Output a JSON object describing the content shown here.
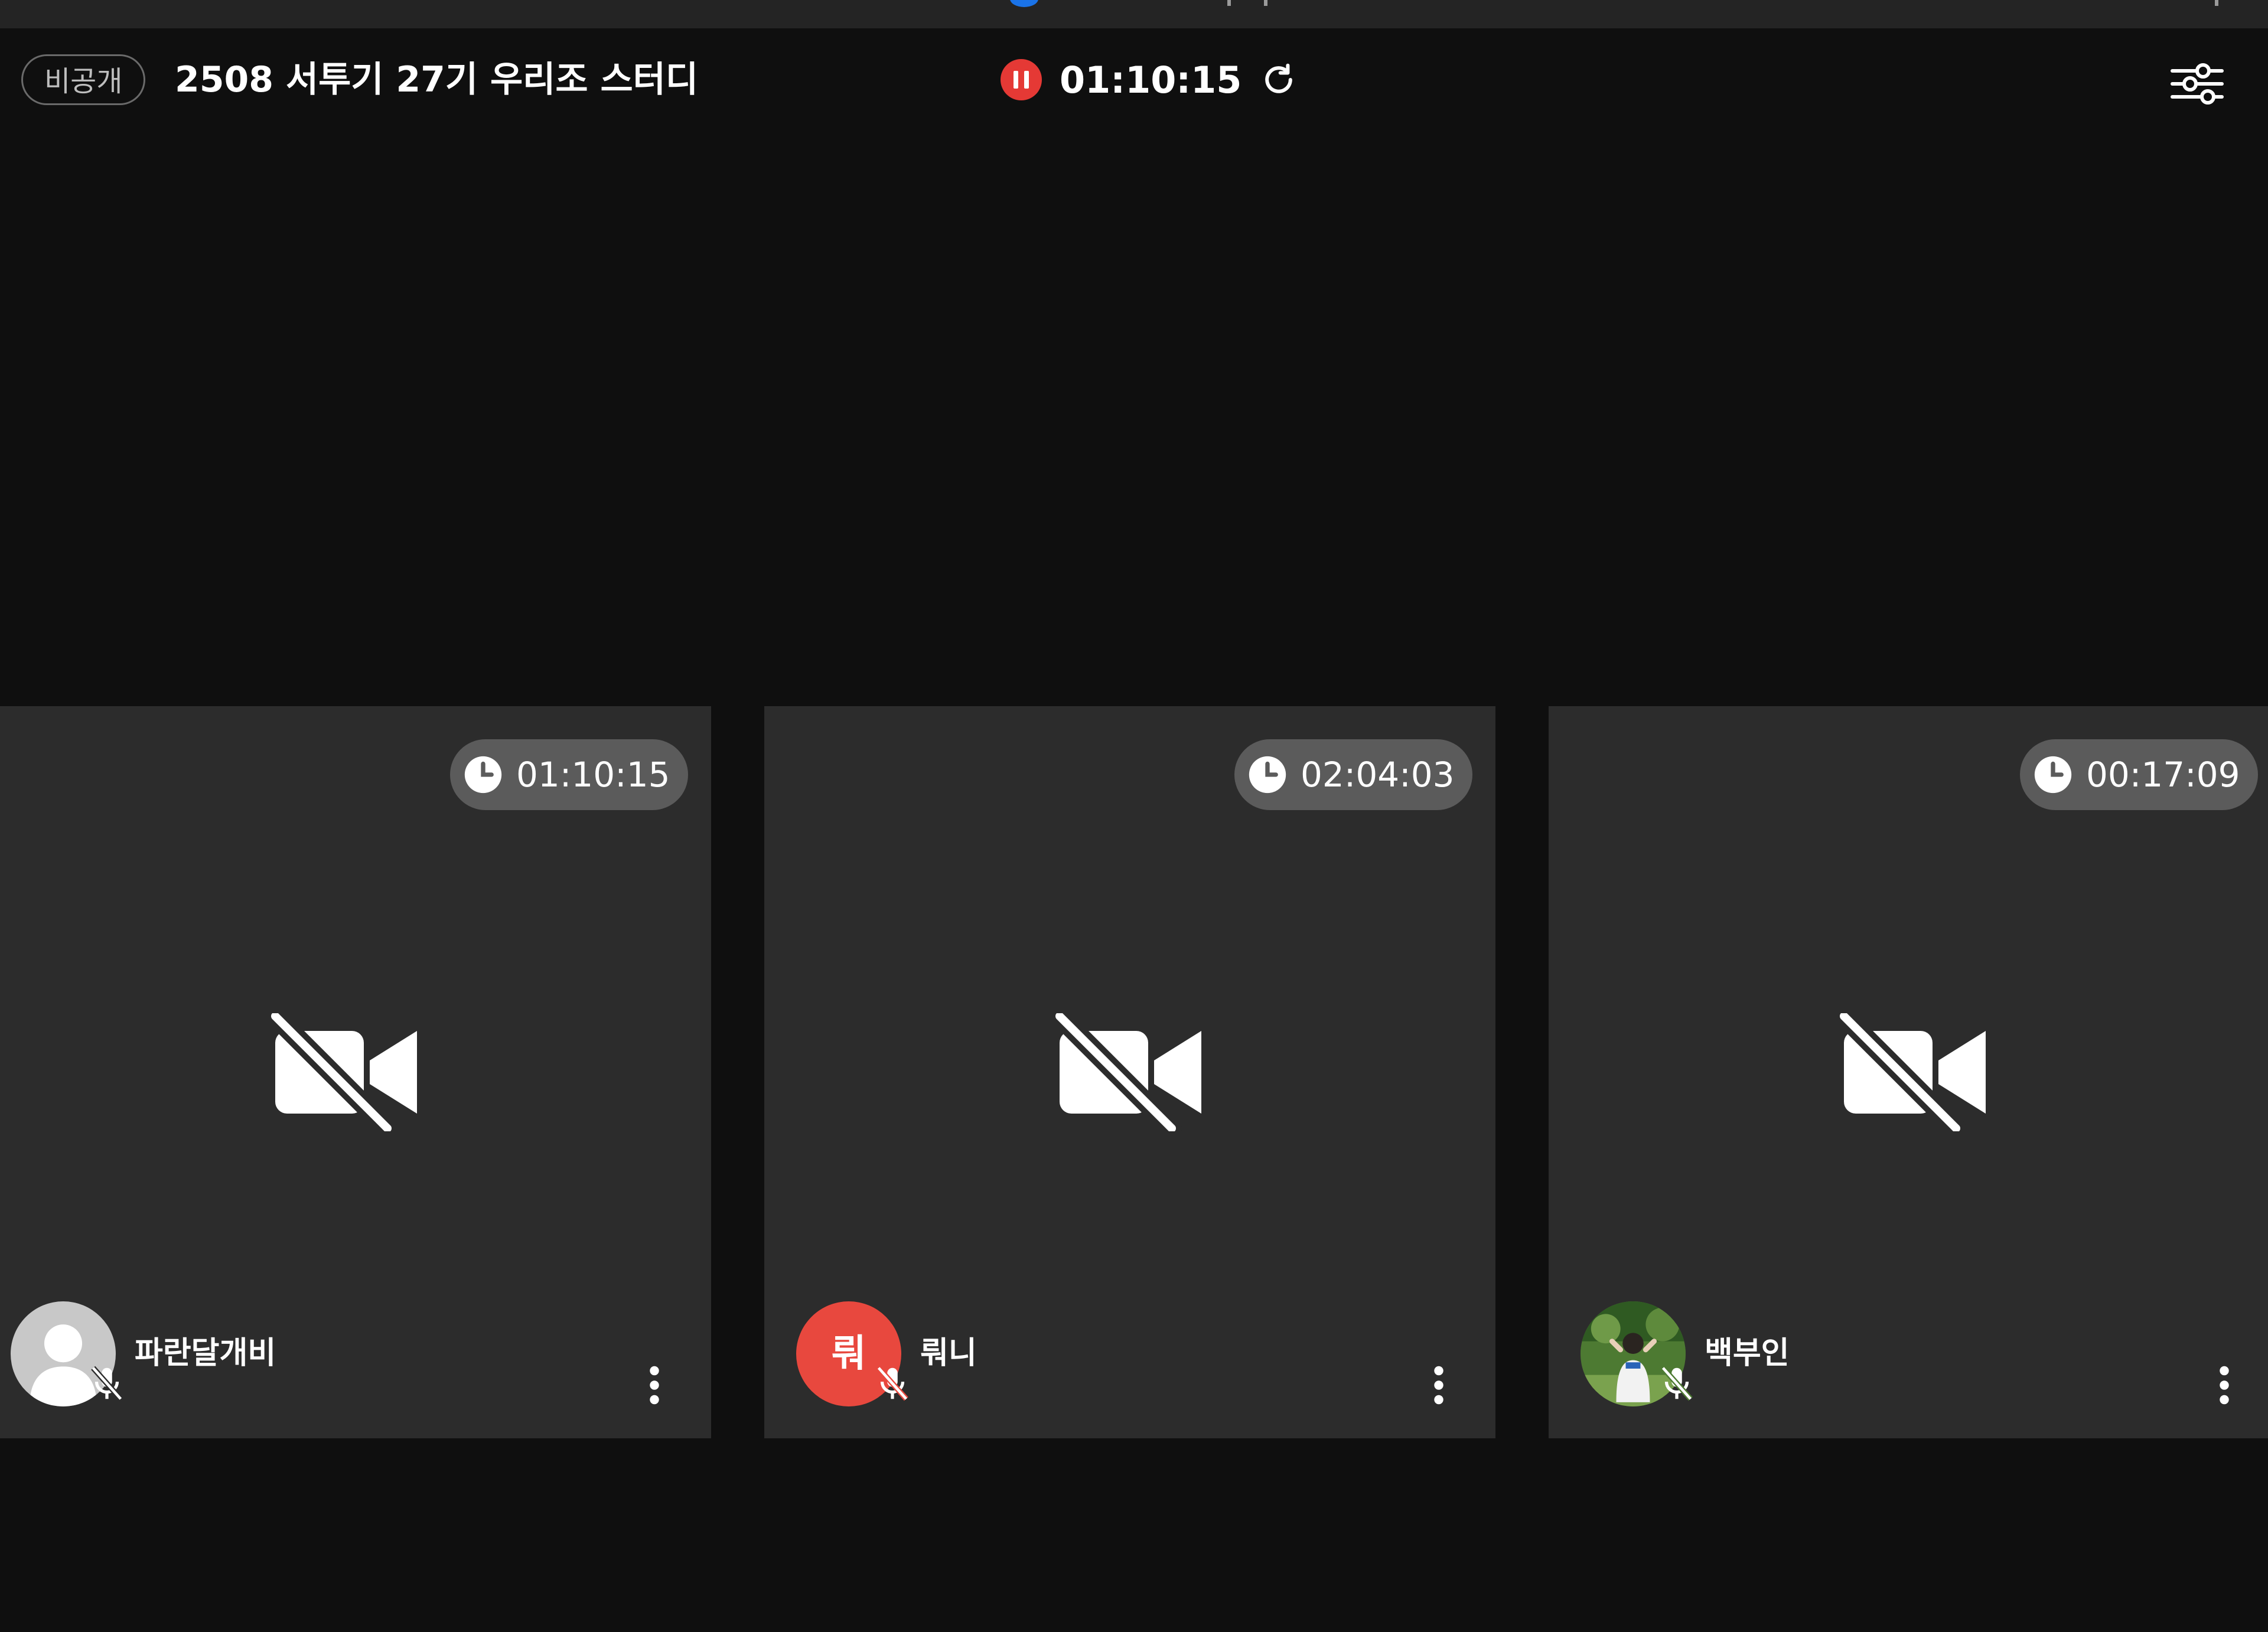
{
  "header": {
    "privacy_label": "비공개",
    "room_title": "2508 서투기 27기 우리조 스터디",
    "session_time": "01:10:15",
    "pause_icon": "pause-circle-icon",
    "reset_icon": "refresh-icon",
    "settings_icon": "sliders-icon"
  },
  "participants": [
    {
      "name": "파란달개비",
      "elapsed": "01:10:15",
      "avatar": "default-user-icon",
      "avatar_initial": ""
    },
    {
      "name": "뤄니",
      "elapsed": "02:04:03",
      "avatar": "initial",
      "avatar_initial": "뤄"
    },
    {
      "name": "백부인",
      "elapsed": "00:17:09",
      "avatar": "photo",
      "avatar_initial": ""
    }
  ],
  "colors": {
    "background": "#0f0f0f",
    "tile": "#2c2c2c",
    "badge": "#5b5b5b",
    "recording_red": "#e53935",
    "avatar_red": "#e8483e"
  }
}
